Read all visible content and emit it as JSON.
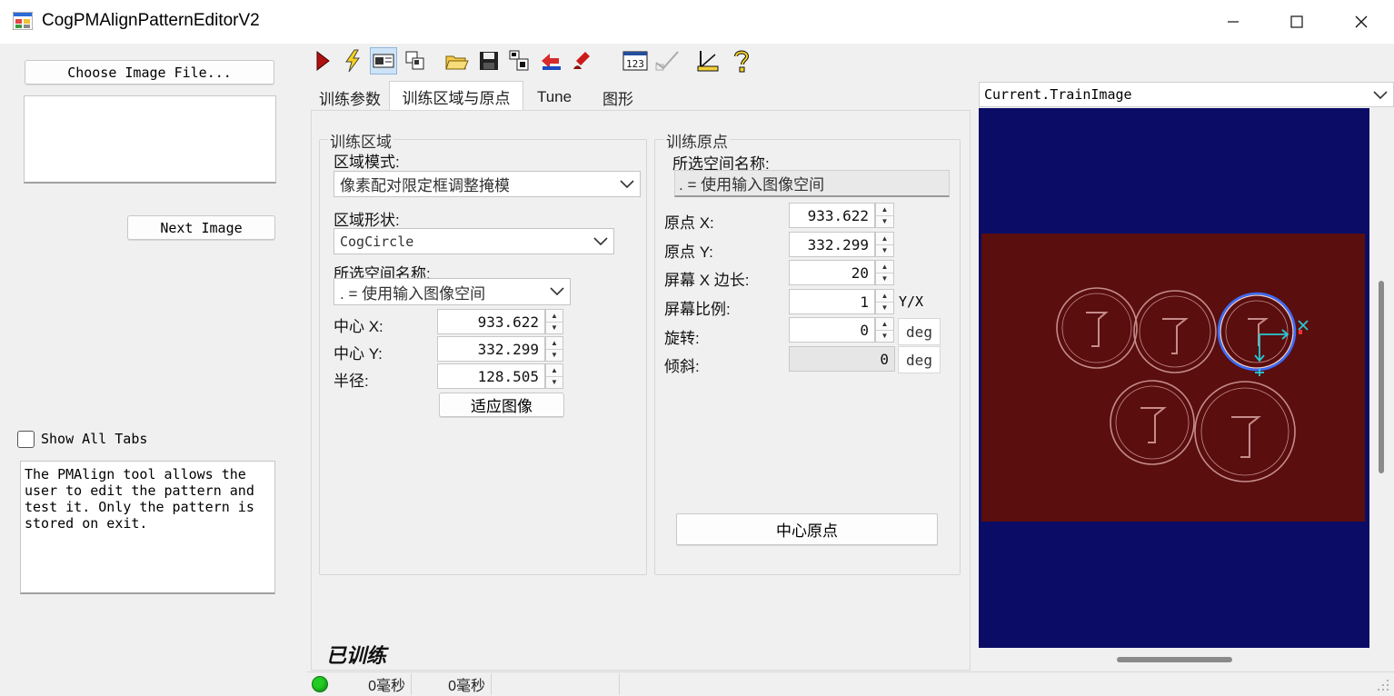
{
  "window": {
    "title": "CogPMAlignPatternEditorV2",
    "minimize_label": "—",
    "maximize_label": "☐",
    "close_label": "✕"
  },
  "left_panel": {
    "choose_image_label": "Choose Image File...",
    "next_image_label": "Next Image",
    "show_all_tabs_label": "Show All Tabs",
    "show_all_tabs_checked": false,
    "description": "The PMAlign tool allows the user to edit the pattern and test it. Only the pattern is stored on exit."
  },
  "toolbar": {
    "icons": [
      "run-icon",
      "train-icon",
      "view-toggle-icon",
      "copy-region-icon",
      "open-file-icon",
      "save-icon",
      "grab-image-icon",
      "load-image-icon",
      "reset-icon",
      "numeric-display-icon",
      "draw-graphics-icon",
      "measure-icon",
      "help-icon"
    ]
  },
  "tabs": [
    {
      "label": "训练参数",
      "active": false
    },
    {
      "label": "训练区域与原点",
      "active": true
    },
    {
      "label": "Tune",
      "active": false
    },
    {
      "label": "图形",
      "active": false
    }
  ],
  "train_region": {
    "group_title": "训练区域",
    "region_mode_label": "区域模式:",
    "region_mode_value": "像素配对限定框调整掩模",
    "region_shape_label": "区域形状:",
    "region_shape_value": "CogCircle",
    "space_name_label": "所选空间名称:",
    "space_name_value": ". = 使用输入图像空间",
    "center_x_label": "中心 X:",
    "center_x_value": "933.622",
    "center_y_label": "中心 Y:",
    "center_y_value": "332.299",
    "radius_label": "半径:",
    "radius_value": "128.505",
    "fit_image_label": "适应图像"
  },
  "train_origin": {
    "group_title": "训练原点",
    "space_name_label": "所选空间名称:",
    "space_name_value": ". = 使用输入图像空间",
    "origin_x_label": "原点 X:",
    "origin_x_value": "933.622",
    "origin_y_label": "原点 Y:",
    "origin_y_value": "332.299",
    "screen_x_len_label": "屏幕 X 边长:",
    "screen_x_len_value": "20",
    "screen_ratio_label": "屏幕比例:",
    "screen_ratio_value": "1",
    "screen_ratio_unit": "Y/X",
    "rotation_label": "旋转:",
    "rotation_value": "0",
    "rotation_unit": "deg",
    "skew_label": "倾斜:",
    "skew_value": "0",
    "skew_unit": "deg",
    "center_origin_label": "中心原点"
  },
  "trained_status": "已训练",
  "status_bar": {
    "indicator_color": "#22cc22",
    "time1": "0毫秒",
    "time2": "0毫秒"
  },
  "image_view": {
    "selector_value": "Current.TrainImage",
    "background_color": "#0b0c66",
    "image_tint": "#5a0e0e",
    "region_color": "#3a6cff",
    "origin_color": "#27c9d6"
  }
}
